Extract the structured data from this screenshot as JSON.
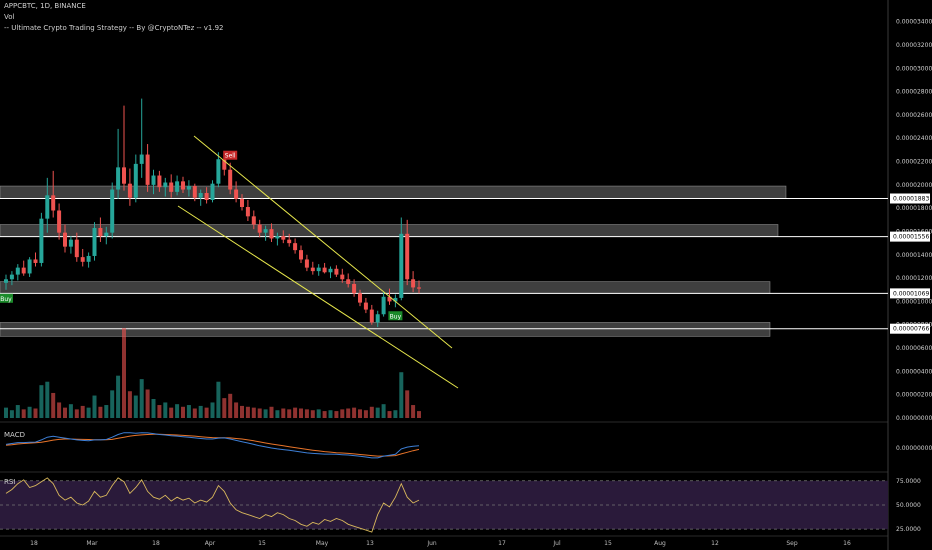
{
  "header": {
    "symbol_line": "APPCBTC, 1D, BINANCE",
    "vol_label": "Vol",
    "strategy_label": "-- Ultimate Crypto Trading Strategy -- By @CryptoNTez -- v1.92"
  },
  "panes": {
    "macd_label": "MACD",
    "rsi_label": "RSI"
  },
  "colors": {
    "background": "#000000",
    "up": "#26a69a",
    "down": "#ef5350",
    "channel": "#e6e64c",
    "zone": "#8c8c8c",
    "macd": "#3d7fd6",
    "signal": "#e8742a",
    "rsi": "#d9b85c",
    "rsi_band": "#2a1a3a"
  },
  "chart_data": {
    "type": "candlestick",
    "x_labels": [
      "18",
      "Mar",
      "18",
      "Apr",
      "15",
      "May",
      "13",
      "Jun",
      "17",
      "Jul",
      "15",
      "Aug",
      "12",
      "Sep",
      "16"
    ],
    "price_ticks": [
      "0.00003400",
      "0.00003200",
      "0.00003000",
      "0.00002800",
      "0.00002600",
      "0.00002400",
      "0.00002200",
      "0.00002000",
      "0.00001800",
      "0.00001600",
      "0.00001400",
      "0.00001200",
      "0.00001000",
      "0.00000800",
      "0.00000600",
      "0.00000400",
      "0.00000200",
      "0.00000000"
    ],
    "price_ylim": [
      0,
      3.5e-05
    ],
    "level_labels": [
      {
        "value": 1.883e-05,
        "label": "0.00001883"
      },
      {
        "value": 1.556e-05,
        "label": "0.00001556"
      },
      {
        "value": 1.069e-05,
        "label": "0.00001069"
      },
      {
        "value": 7.66e-06,
        "label": "0.00000766"
      }
    ],
    "zones": [
      [
        1.883e-05,
        1.99e-05
      ],
      [
        1.556e-05,
        1.66e-05
      ],
      [
        1.069e-05,
        1.17e-05
      ],
      [
        7e-06,
        8.2e-06
      ]
    ],
    "signals": [
      {
        "type": "Buy",
        "date_index": 0
      },
      {
        "type": "Sell",
        "date_index": 38
      },
      {
        "type": "Buy",
        "date_index": 66
      }
    ],
    "macd_ticks": [
      "0.00000000"
    ],
    "rsi_ticks": [
      "75.0000",
      "50.0000",
      "25.0000"
    ],
    "rsi_ylim": [
      25,
      75
    ],
    "candles": [
      {
        "o": 11.6,
        "h": 12.3,
        "l": 11.0,
        "c": 11.9
      },
      {
        "o": 11.9,
        "h": 12.6,
        "l": 11.4,
        "c": 12.3
      },
      {
        "o": 12.3,
        "h": 13.2,
        "l": 11.8,
        "c": 12.9
      },
      {
        "o": 12.9,
        "h": 13.5,
        "l": 12.2,
        "c": 12.4
      },
      {
        "o": 12.4,
        "h": 13.8,
        "l": 12.1,
        "c": 13.6
      },
      {
        "o": 13.6,
        "h": 14.2,
        "l": 13.0,
        "c": 13.3
      },
      {
        "o": 13.3,
        "h": 17.6,
        "l": 13.0,
        "c": 17.1
      },
      {
        "o": 17.1,
        "h": 20.6,
        "l": 15.9,
        "c": 19.1
      },
      {
        "o": 19.1,
        "h": 21.2,
        "l": 17.2,
        "c": 17.8
      },
      {
        "o": 17.8,
        "h": 18.4,
        "l": 15.3,
        "c": 15.9
      },
      {
        "o": 15.9,
        "h": 16.6,
        "l": 14.2,
        "c": 14.7
      },
      {
        "o": 14.7,
        "h": 15.6,
        "l": 14.1,
        "c": 15.3
      },
      {
        "o": 15.3,
        "h": 15.9,
        "l": 13.4,
        "c": 13.8
      },
      {
        "o": 13.8,
        "h": 14.5,
        "l": 13.0,
        "c": 13.4
      },
      {
        "o": 13.4,
        "h": 14.2,
        "l": 12.9,
        "c": 13.9
      },
      {
        "o": 13.9,
        "h": 16.8,
        "l": 13.5,
        "c": 16.3
      },
      {
        "o": 16.3,
        "h": 17.2,
        "l": 15.1,
        "c": 15.6
      },
      {
        "o": 15.6,
        "h": 16.4,
        "l": 14.9,
        "c": 15.9
      },
      {
        "o": 15.9,
        "h": 20.2,
        "l": 15.4,
        "c": 19.6
      },
      {
        "o": 19.6,
        "h": 24.8,
        "l": 18.8,
        "c": 21.5
      },
      {
        "o": 21.5,
        "h": 26.8,
        "l": 19.5,
        "c": 20.1
      },
      {
        "o": 20.1,
        "h": 21.4,
        "l": 18.2,
        "c": 18.9
      },
      {
        "o": 18.9,
        "h": 22.6,
        "l": 18.5,
        "c": 21.8
      },
      {
        "o": 21.8,
        "h": 27.4,
        "l": 20.6,
        "c": 22.6
      },
      {
        "o": 22.6,
        "h": 23.5,
        "l": 19.4,
        "c": 20.0
      },
      {
        "o": 20.0,
        "h": 21.3,
        "l": 19.2,
        "c": 20.8
      },
      {
        "o": 20.8,
        "h": 21.2,
        "l": 19.4,
        "c": 19.8
      },
      {
        "o": 19.8,
        "h": 20.6,
        "l": 19.0,
        "c": 20.2
      },
      {
        "o": 20.2,
        "h": 20.9,
        "l": 18.9,
        "c": 19.4
      },
      {
        "o": 19.4,
        "h": 20.8,
        "l": 19.1,
        "c": 20.3
      },
      {
        "o": 20.3,
        "h": 20.7,
        "l": 19.3,
        "c": 19.6
      },
      {
        "o": 19.6,
        "h": 20.4,
        "l": 19.0,
        "c": 19.9
      },
      {
        "o": 19.9,
        "h": 20.1,
        "l": 18.6,
        "c": 18.9
      },
      {
        "o": 18.9,
        "h": 19.6,
        "l": 18.2,
        "c": 19.3
      },
      {
        "o": 19.3,
        "h": 19.8,
        "l": 18.4,
        "c": 18.7
      },
      {
        "o": 18.7,
        "h": 20.4,
        "l": 18.5,
        "c": 20.1
      },
      {
        "o": 20.1,
        "h": 22.8,
        "l": 19.8,
        "c": 22.2
      },
      {
        "o": 22.2,
        "h": 22.5,
        "l": 20.8,
        "c": 21.3
      },
      {
        "o": 21.3,
        "h": 21.9,
        "l": 19.2,
        "c": 19.6
      },
      {
        "o": 19.6,
        "h": 20.3,
        "l": 18.5,
        "c": 18.8
      },
      {
        "o": 18.8,
        "h": 19.2,
        "l": 17.8,
        "c": 18.1
      },
      {
        "o": 18.1,
        "h": 18.7,
        "l": 16.9,
        "c": 17.3
      },
      {
        "o": 17.3,
        "h": 17.8,
        "l": 16.2,
        "c": 16.6
      },
      {
        "o": 16.6,
        "h": 17.0,
        "l": 15.5,
        "c": 15.9
      },
      {
        "o": 15.9,
        "h": 16.5,
        "l": 15.2,
        "c": 16.2
      },
      {
        "o": 16.2,
        "h": 16.7,
        "l": 15.1,
        "c": 15.4
      },
      {
        "o": 15.4,
        "h": 15.9,
        "l": 14.8,
        "c": 15.6
      },
      {
        "o": 15.6,
        "h": 16.1,
        "l": 15.0,
        "c": 15.3
      },
      {
        "o": 15.3,
        "h": 15.8,
        "l": 14.7,
        "c": 15.0
      },
      {
        "o": 15.0,
        "h": 15.4,
        "l": 14.1,
        "c": 14.4
      },
      {
        "o": 14.4,
        "h": 14.8,
        "l": 13.3,
        "c": 13.6
      },
      {
        "o": 13.6,
        "h": 14.0,
        "l": 12.6,
        "c": 12.9
      },
      {
        "o": 12.9,
        "h": 13.4,
        "l": 12.3,
        "c": 12.6
      },
      {
        "o": 12.6,
        "h": 13.2,
        "l": 12.2,
        "c": 12.9
      },
      {
        "o": 12.9,
        "h": 13.3,
        "l": 12.4,
        "c": 12.5
      },
      {
        "o": 12.5,
        "h": 13.0,
        "l": 12.0,
        "c": 12.8
      },
      {
        "o": 12.8,
        "h": 13.1,
        "l": 12.1,
        "c": 12.3
      },
      {
        "o": 12.3,
        "h": 12.8,
        "l": 11.6,
        "c": 11.9
      },
      {
        "o": 11.9,
        "h": 12.4,
        "l": 11.2,
        "c": 11.5
      },
      {
        "o": 11.5,
        "h": 11.9,
        "l": 10.4,
        "c": 10.7
      },
      {
        "o": 10.7,
        "h": 11.0,
        "l": 9.6,
        "c": 9.9
      },
      {
        "o": 9.9,
        "h": 10.3,
        "l": 9.0,
        "c": 9.3
      },
      {
        "o": 9.3,
        "h": 9.7,
        "l": 8.0,
        "c": 8.2
      },
      {
        "o": 8.2,
        "h": 9.2,
        "l": 7.8,
        "c": 8.9
      },
      {
        "o": 8.9,
        "h": 10.8,
        "l": 8.7,
        "c": 10.4
      },
      {
        "o": 10.4,
        "h": 11.1,
        "l": 9.7,
        "c": 10.0
      },
      {
        "o": 10.0,
        "h": 10.6,
        "l": 9.5,
        "c": 10.3
      },
      {
        "o": 10.3,
        "h": 17.2,
        "l": 10.1,
        "c": 15.8
      },
      {
        "o": 15.8,
        "h": 17.0,
        "l": 11.4,
        "c": 11.9
      },
      {
        "o": 11.9,
        "h": 12.6,
        "l": 10.8,
        "c": 11.2
      },
      {
        "o": 11.2,
        "h": 11.8,
        "l": 10.7,
        "c": 11.1
      }
    ],
    "volumes": [
      1.2,
      0.9,
      1.5,
      1.0,
      1.3,
      1.1,
      3.8,
      4.2,
      2.9,
      1.8,
      1.2,
      1.6,
      1.0,
      1.4,
      1.2,
      2.6,
      1.3,
      1.5,
      3.2,
      4.9,
      10.4,
      3.1,
      2.6,
      4.5,
      3.3,
      2.2,
      1.5,
      1.8,
      1.2,
      1.6,
      1.3,
      1.5,
      1.1,
      1.4,
      1.2,
      1.8,
      4.2,
      2.3,
      2.8,
      1.8,
      1.4,
      1.3,
      1.2,
      1.1,
      1.0,
      1.3,
      0.9,
      1.1,
      1.0,
      1.2,
      1.1,
      1.0,
      0.9,
      1.0,
      0.8,
      0.9,
      0.8,
      1.0,
      1.1,
      1.2,
      1.0,
      0.9,
      1.3,
      1.2,
      1.6,
      0.8,
      0.9,
      5.3,
      3.2,
      1.5,
      0.8
    ],
    "macd": [
      0.2,
      0.25,
      0.3,
      0.3,
      0.32,
      0.33,
      0.45,
      0.6,
      0.65,
      0.6,
      0.55,
      0.5,
      0.45,
      0.42,
      0.4,
      0.45,
      0.45,
      0.47,
      0.6,
      0.75,
      0.85,
      0.85,
      0.82,
      0.85,
      0.84,
      0.8,
      0.75,
      0.72,
      0.68,
      0.66,
      0.63,
      0.6,
      0.56,
      0.53,
      0.5,
      0.5,
      0.55,
      0.56,
      0.5,
      0.42,
      0.35,
      0.28,
      0.2,
      0.12,
      0.06,
      0.0,
      -0.05,
      -0.09,
      -0.13,
      -0.17,
      -0.22,
      -0.27,
      -0.3,
      -0.32,
      -0.34,
      -0.34,
      -0.35,
      -0.37,
      -0.39,
      -0.42,
      -0.46,
      -0.5,
      -0.55,
      -0.55,
      -0.45,
      -0.4,
      -0.35,
      -0.05,
      0.05,
      0.1,
      0.12
    ],
    "signal_line": [
      0.15,
      0.18,
      0.22,
      0.25,
      0.27,
      0.29,
      0.32,
      0.38,
      0.44,
      0.48,
      0.5,
      0.5,
      0.49,
      0.48,
      0.47,
      0.46,
      0.46,
      0.46,
      0.48,
      0.54,
      0.6,
      0.66,
      0.7,
      0.73,
      0.75,
      0.76,
      0.76,
      0.75,
      0.74,
      0.72,
      0.7,
      0.68,
      0.66,
      0.63,
      0.6,
      0.58,
      0.57,
      0.57,
      0.56,
      0.53,
      0.5,
      0.45,
      0.4,
      0.34,
      0.28,
      0.22,
      0.17,
      0.12,
      0.07,
      0.02,
      -0.03,
      -0.08,
      -0.12,
      -0.16,
      -0.2,
      -0.23,
      -0.26,
      -0.28,
      -0.3,
      -0.33,
      -0.36,
      -0.39,
      -0.42,
      -0.45,
      -0.45,
      -0.44,
      -0.42,
      -0.33,
      -0.24,
      -0.15,
      -0.08
    ],
    "rsi": [
      62,
      66,
      72,
      76,
      68,
      70,
      74,
      78,
      72,
      60,
      55,
      58,
      52,
      50,
      54,
      64,
      58,
      60,
      70,
      78,
      74,
      62,
      68,
      76,
      64,
      58,
      56,
      60,
      54,
      58,
      55,
      57,
      52,
      55,
      53,
      58,
      70,
      64,
      52,
      45,
      42,
      40,
      38,
      36,
      40,
      38,
      42,
      40,
      36,
      34,
      30,
      28,
      32,
      30,
      35,
      33,
      36,
      34,
      30,
      28,
      26,
      24,
      22,
      40,
      52,
      48,
      58,
      72,
      58,
      52,
      55
    ]
  }
}
